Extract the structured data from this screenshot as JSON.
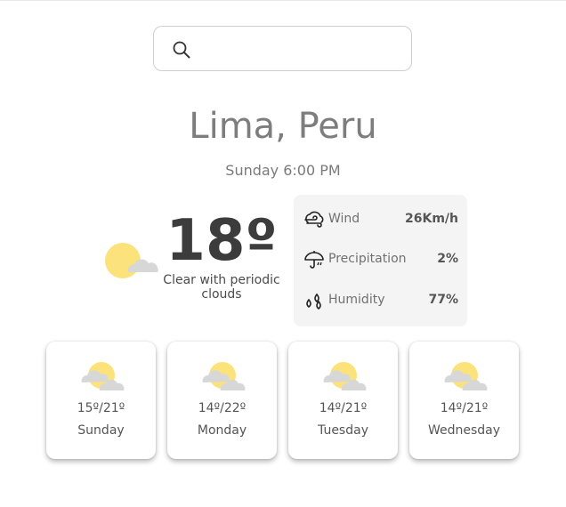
{
  "search": {
    "value": "",
    "placeholder": ""
  },
  "location": {
    "city": "Lima, Peru",
    "datetime": "Sunday 6:00 PM"
  },
  "current": {
    "temperature": "18º",
    "condition": "Clear with periodic clouds",
    "icon": "sun-cloud-icon"
  },
  "stats": [
    {
      "label": "Wind",
      "value": "26Km/h",
      "icon": "wind-cloud-icon"
    },
    {
      "label": "Precipitation",
      "value": "2%",
      "icon": "umbrella-icon"
    },
    {
      "label": "Humidity",
      "value": "77%",
      "icon": "water-drops-icon"
    }
  ],
  "forecast": [
    {
      "range": "15º/21º",
      "day": "Sunday",
      "icon": "sun-cloud-icon"
    },
    {
      "range": "14º/22º",
      "day": "Monday",
      "icon": "sun-cloud-icon"
    },
    {
      "range": "14º/21º",
      "day": "Tuesday",
      "icon": "sun-cloud-icon"
    },
    {
      "range": "14º/21º",
      "day": "Wednesday",
      "icon": "sun-cloud-icon"
    }
  ],
  "colors": {
    "sun": "#fbe27a",
    "cloud": "#d7d7d7",
    "panel": "#f4f4f4",
    "text": "#555555"
  }
}
